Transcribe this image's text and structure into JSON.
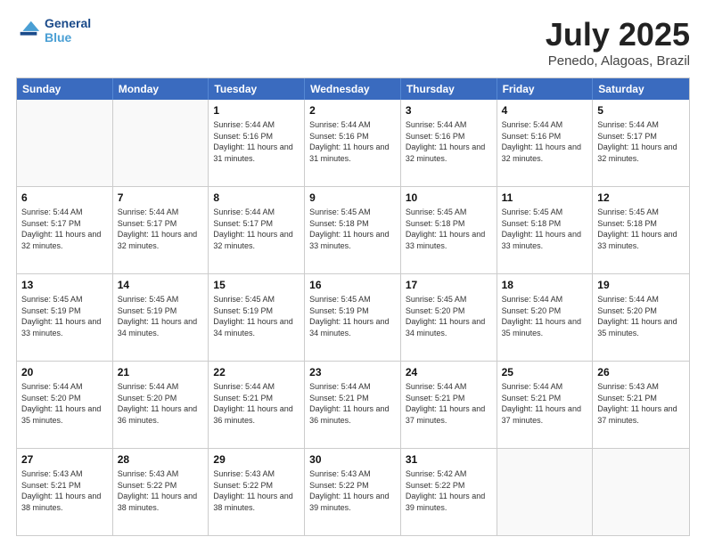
{
  "header": {
    "logo_line1": "General",
    "logo_line2": "Blue",
    "title": "July 2025",
    "subtitle": "Penedo, Alagoas, Brazil"
  },
  "calendar": {
    "days_of_week": [
      "Sunday",
      "Monday",
      "Tuesday",
      "Wednesday",
      "Thursday",
      "Friday",
      "Saturday"
    ],
    "rows": [
      [
        {
          "day": "",
          "info": ""
        },
        {
          "day": "",
          "info": ""
        },
        {
          "day": "1",
          "info": "Sunrise: 5:44 AM\nSunset: 5:16 PM\nDaylight: 11 hours and 31 minutes."
        },
        {
          "day": "2",
          "info": "Sunrise: 5:44 AM\nSunset: 5:16 PM\nDaylight: 11 hours and 31 minutes."
        },
        {
          "day": "3",
          "info": "Sunrise: 5:44 AM\nSunset: 5:16 PM\nDaylight: 11 hours and 32 minutes."
        },
        {
          "day": "4",
          "info": "Sunrise: 5:44 AM\nSunset: 5:16 PM\nDaylight: 11 hours and 32 minutes."
        },
        {
          "day": "5",
          "info": "Sunrise: 5:44 AM\nSunset: 5:17 PM\nDaylight: 11 hours and 32 minutes."
        }
      ],
      [
        {
          "day": "6",
          "info": "Sunrise: 5:44 AM\nSunset: 5:17 PM\nDaylight: 11 hours and 32 minutes."
        },
        {
          "day": "7",
          "info": "Sunrise: 5:44 AM\nSunset: 5:17 PM\nDaylight: 11 hours and 32 minutes."
        },
        {
          "day": "8",
          "info": "Sunrise: 5:44 AM\nSunset: 5:17 PM\nDaylight: 11 hours and 32 minutes."
        },
        {
          "day": "9",
          "info": "Sunrise: 5:45 AM\nSunset: 5:18 PM\nDaylight: 11 hours and 33 minutes."
        },
        {
          "day": "10",
          "info": "Sunrise: 5:45 AM\nSunset: 5:18 PM\nDaylight: 11 hours and 33 minutes."
        },
        {
          "day": "11",
          "info": "Sunrise: 5:45 AM\nSunset: 5:18 PM\nDaylight: 11 hours and 33 minutes."
        },
        {
          "day": "12",
          "info": "Sunrise: 5:45 AM\nSunset: 5:18 PM\nDaylight: 11 hours and 33 minutes."
        }
      ],
      [
        {
          "day": "13",
          "info": "Sunrise: 5:45 AM\nSunset: 5:19 PM\nDaylight: 11 hours and 33 minutes."
        },
        {
          "day": "14",
          "info": "Sunrise: 5:45 AM\nSunset: 5:19 PM\nDaylight: 11 hours and 34 minutes."
        },
        {
          "day": "15",
          "info": "Sunrise: 5:45 AM\nSunset: 5:19 PM\nDaylight: 11 hours and 34 minutes."
        },
        {
          "day": "16",
          "info": "Sunrise: 5:45 AM\nSunset: 5:19 PM\nDaylight: 11 hours and 34 minutes."
        },
        {
          "day": "17",
          "info": "Sunrise: 5:45 AM\nSunset: 5:20 PM\nDaylight: 11 hours and 34 minutes."
        },
        {
          "day": "18",
          "info": "Sunrise: 5:44 AM\nSunset: 5:20 PM\nDaylight: 11 hours and 35 minutes."
        },
        {
          "day": "19",
          "info": "Sunrise: 5:44 AM\nSunset: 5:20 PM\nDaylight: 11 hours and 35 minutes."
        }
      ],
      [
        {
          "day": "20",
          "info": "Sunrise: 5:44 AM\nSunset: 5:20 PM\nDaylight: 11 hours and 35 minutes."
        },
        {
          "day": "21",
          "info": "Sunrise: 5:44 AM\nSunset: 5:20 PM\nDaylight: 11 hours and 36 minutes."
        },
        {
          "day": "22",
          "info": "Sunrise: 5:44 AM\nSunset: 5:21 PM\nDaylight: 11 hours and 36 minutes."
        },
        {
          "day": "23",
          "info": "Sunrise: 5:44 AM\nSunset: 5:21 PM\nDaylight: 11 hours and 36 minutes."
        },
        {
          "day": "24",
          "info": "Sunrise: 5:44 AM\nSunset: 5:21 PM\nDaylight: 11 hours and 37 minutes."
        },
        {
          "day": "25",
          "info": "Sunrise: 5:44 AM\nSunset: 5:21 PM\nDaylight: 11 hours and 37 minutes."
        },
        {
          "day": "26",
          "info": "Sunrise: 5:43 AM\nSunset: 5:21 PM\nDaylight: 11 hours and 37 minutes."
        }
      ],
      [
        {
          "day": "27",
          "info": "Sunrise: 5:43 AM\nSunset: 5:21 PM\nDaylight: 11 hours and 38 minutes."
        },
        {
          "day": "28",
          "info": "Sunrise: 5:43 AM\nSunset: 5:22 PM\nDaylight: 11 hours and 38 minutes."
        },
        {
          "day": "29",
          "info": "Sunrise: 5:43 AM\nSunset: 5:22 PM\nDaylight: 11 hours and 38 minutes."
        },
        {
          "day": "30",
          "info": "Sunrise: 5:43 AM\nSunset: 5:22 PM\nDaylight: 11 hours and 39 minutes."
        },
        {
          "day": "31",
          "info": "Sunrise: 5:42 AM\nSunset: 5:22 PM\nDaylight: 11 hours and 39 minutes."
        },
        {
          "day": "",
          "info": ""
        },
        {
          "day": "",
          "info": ""
        }
      ]
    ]
  }
}
